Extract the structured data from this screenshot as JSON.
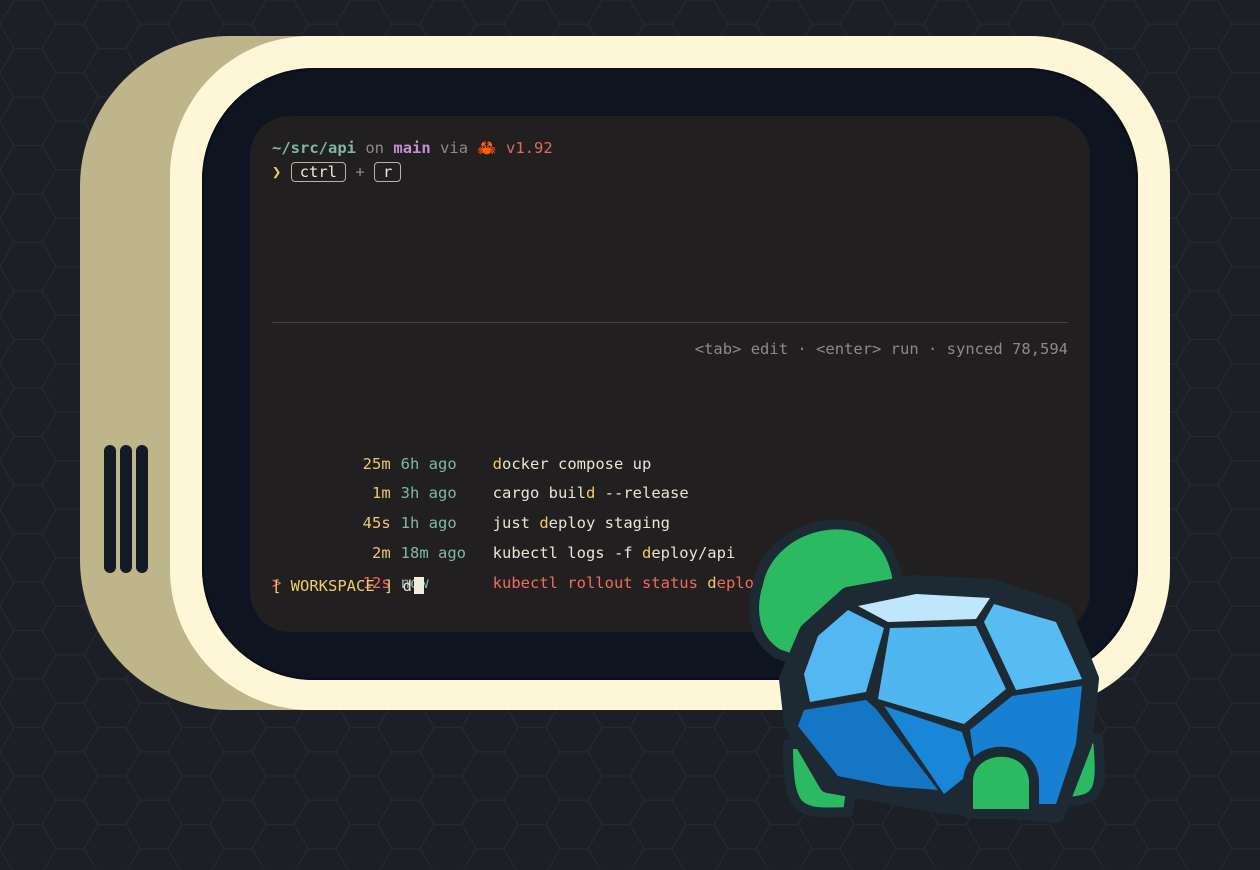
{
  "prompt": {
    "path": "~/src/api",
    "on": "on",
    "branch": "main",
    "via": "via",
    "lang_icon": "🦀",
    "version": "v1.92"
  },
  "command_line": {
    "arrow": "❯",
    "key1": "ctrl",
    "plus": "+",
    "key2": "r"
  },
  "hints": "<tab> edit · <enter> run · synced 78,594",
  "history": [
    {
      "duration": "25m",
      "ago": "6h ago",
      "pre": "",
      "match": "d",
      "post": "ocker compose up",
      "selected": false
    },
    {
      "duration": "1m",
      "ago": "3h ago",
      "pre": "cargo buil",
      "match": "d",
      "post": " --release",
      "selected": false
    },
    {
      "duration": "45s",
      "ago": "1h ago",
      "pre": "just ",
      "match": "d",
      "post": "eploy staging",
      "selected": false
    },
    {
      "duration": "2m",
      "ago": "18m ago",
      "pre": "kubectl logs -f ",
      "match": "d",
      "post": "eploy/api",
      "selected": false
    },
    {
      "duration": "12s",
      "ago": "now",
      "pre": "kubectl rollout status ",
      "match": "d",
      "post": "eploy/api",
      "selected": true
    }
  ],
  "selected_marker": ">",
  "filter": {
    "label": "[ WORKSPACE ]",
    "query": "d"
  },
  "colors": {
    "background": "#1d1f27",
    "shell": "#fdf7d8",
    "terminal": "#221f21",
    "accent_red": "#f06c5c",
    "accent_yellow": "#efcc69"
  }
}
